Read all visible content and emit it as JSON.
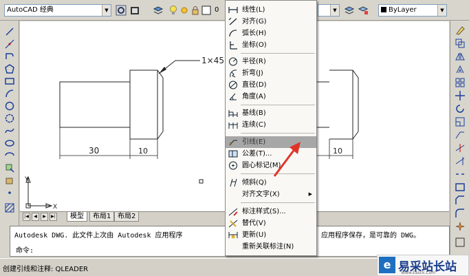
{
  "toolbar": {
    "workspace": "AutoCAD 经典",
    "layer_number": "0",
    "linetype": "ByLayer"
  },
  "tabs": [
    "模型",
    "布局1",
    "布局2"
  ],
  "drawing": {
    "leader_text": "1×45",
    "dim_left": "30",
    "dim_left2": "10",
    "dim_right": "10",
    "ucs_x": "X",
    "ucs_y": "Y"
  },
  "context_menu": {
    "items": [
      {
        "label": "线性(L)",
        "icon": "linear-dim-icon"
      },
      {
        "label": "对齐(G)",
        "icon": "aligned-dim-icon"
      },
      {
        "label": "弧长(H)",
        "icon": "arc-length-icon"
      },
      {
        "label": "坐标(O)",
        "icon": "ordinate-icon"
      },
      {
        "label": "半径(R)",
        "icon": "radius-icon"
      },
      {
        "label": "折弯(J)",
        "icon": "jogged-icon"
      },
      {
        "label": "直径(D)",
        "icon": "diameter-icon"
      },
      {
        "label": "角度(A)",
        "icon": "angle-icon"
      },
      {
        "label": "基线(B)",
        "icon": "baseline-icon"
      },
      {
        "label": "连续(C)",
        "icon": "continue-icon"
      },
      {
        "label": "引线(E)",
        "icon": "leader-icon"
      },
      {
        "label": "公差(T)...",
        "icon": "tolerance-icon"
      },
      {
        "label": "圆心标记(M)",
        "icon": "center-mark-icon"
      },
      {
        "label": "倾斜(Q)",
        "icon": "oblique-icon"
      },
      {
        "label": "对齐文字(X)",
        "icon": ""
      },
      {
        "label": "标注样式(S)...",
        "icon": "dim-style-icon"
      },
      {
        "label": "替代(V)",
        "icon": "override-icon"
      },
      {
        "label": "更新(U)",
        "icon": "update-icon"
      },
      {
        "label": "重新关联标注(N)",
        "icon": ""
      }
    ]
  },
  "command": {
    "history": "Autodesk DWG.  此文件上次由 Autodesk 应用程序",
    "history_tail": "应用程序保存，是可靠的 DWG。",
    "prompt": "命令:"
  },
  "status": {
    "text": "创建引线和注释:  QLEADER"
  },
  "watermark": {
    "title": "易采站长站",
    "url": "Www.Easck.Com"
  },
  "colors": {
    "highlight": "#a7a7a7",
    "arrow": "#e0342a",
    "canvas": "#ffffff"
  }
}
